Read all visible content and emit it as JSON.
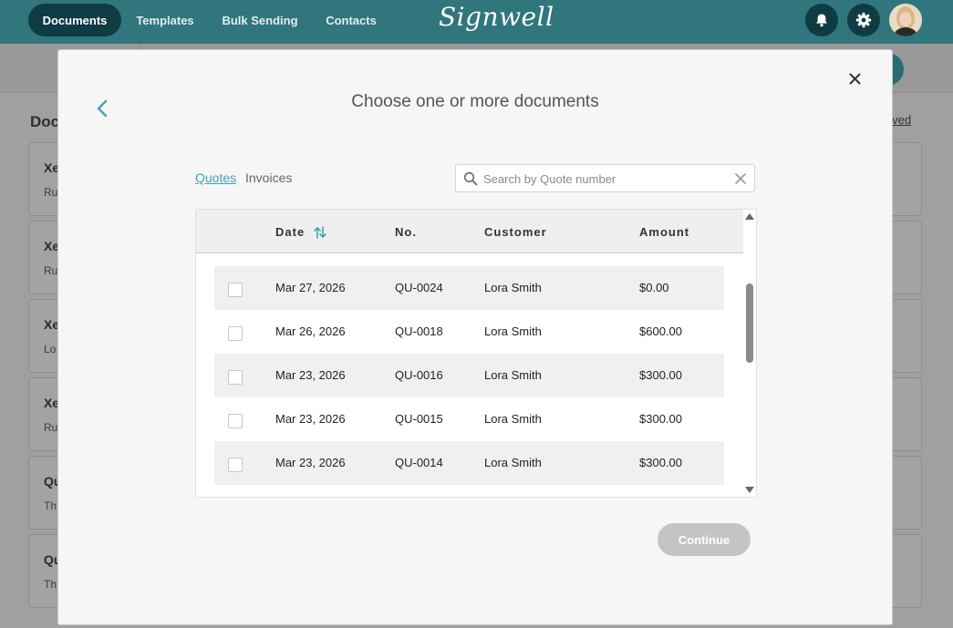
{
  "nav": {
    "items": [
      {
        "label": "Documents",
        "active": true
      },
      {
        "label": "Templates",
        "active": false
      },
      {
        "label": "Bulk Sending",
        "active": false
      },
      {
        "label": "Contacts",
        "active": false
      }
    ],
    "logo": "Signwell",
    "icons": [
      "bell-icon",
      "gear-icon"
    ]
  },
  "background": {
    "heading": "Doc",
    "archived_link": "hived",
    "cards": [
      {
        "title": "Xe",
        "subtitle": "Ru"
      },
      {
        "title": "Xe",
        "subtitle": "Ru"
      },
      {
        "title": "Xe",
        "subtitle": "Lo"
      },
      {
        "title": "Xe",
        "subtitle": "Ru"
      },
      {
        "title": "Qu",
        "subtitle": "Th"
      },
      {
        "title": "Qu",
        "subtitle": "Th"
      }
    ]
  },
  "modal": {
    "title": "Choose one or more documents",
    "tabs": [
      {
        "label": "Quotes",
        "active": true
      },
      {
        "label": "Invoices",
        "active": false
      }
    ],
    "search": {
      "placeholder": "Search by Quote number",
      "value": ""
    },
    "table": {
      "columns": [
        "Date",
        "No.",
        "Customer",
        "Amount"
      ],
      "sorted_by": "Date",
      "rows": [
        {
          "date": "Mar 27, 2026",
          "no": "QU-0024",
          "customer": "Lora Smith",
          "amount": "$0.00",
          "checked": false
        },
        {
          "date": "Mar 26, 2026",
          "no": "QU-0018",
          "customer": "Lora Smith",
          "amount": "$600.00",
          "checked": false
        },
        {
          "date": "Mar 23, 2026",
          "no": "QU-0016",
          "customer": "Lora Smith",
          "amount": "$300.00",
          "checked": false
        },
        {
          "date": "Mar 23, 2026",
          "no": "QU-0015",
          "customer": "Lora Smith",
          "amount": "$300.00",
          "checked": false
        },
        {
          "date": "Mar 23, 2026",
          "no": "QU-0014",
          "customer": "Lora Smith",
          "amount": "$300.00",
          "checked": false
        }
      ]
    },
    "continue_label": "Continue",
    "continue_enabled": false
  },
  "colors": {
    "nav_bg": "#30767c",
    "nav_active": "#0e3c42",
    "accent": "#3fa3b1",
    "disabled_button": "#c4c4c4"
  }
}
